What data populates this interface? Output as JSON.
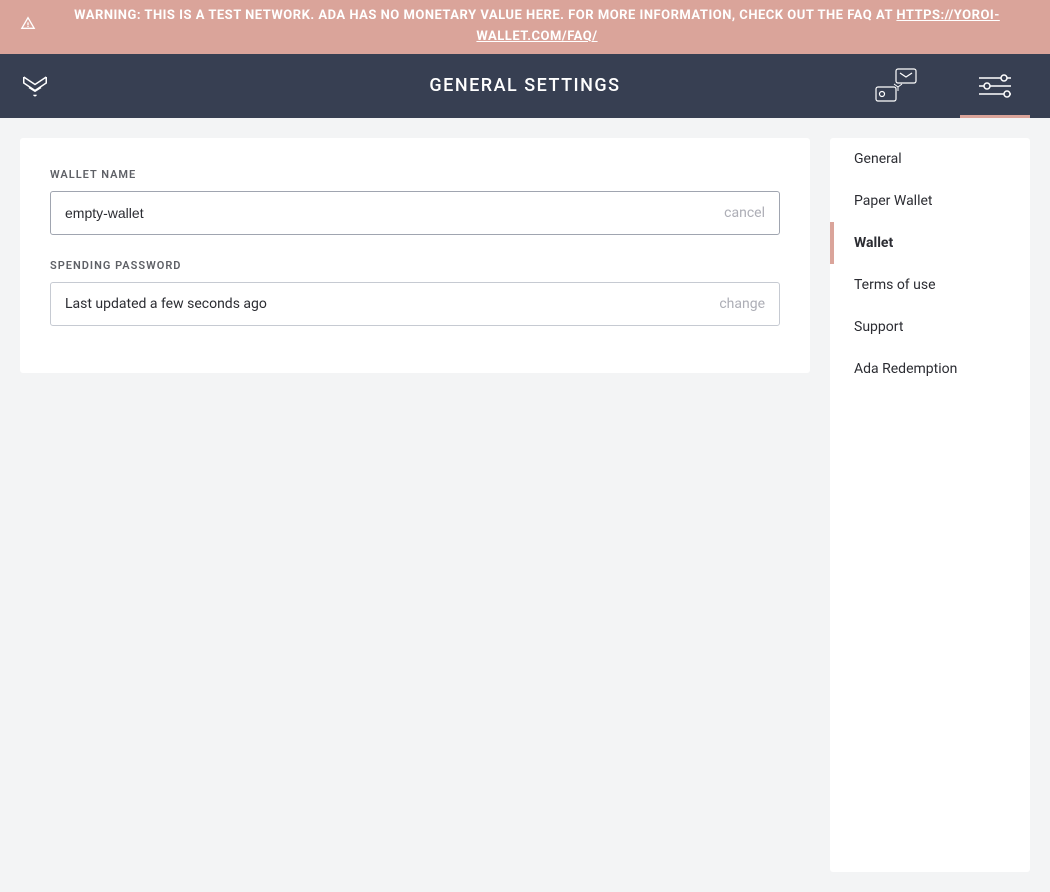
{
  "banner": {
    "warning_text": "WARNING: THIS IS A TEST NETWORK. ADA HAS NO MONETARY VALUE HERE. FOR MORE INFORMATION, CHECK OUT THE FAQ AT ",
    "faq_link_text": "HTTPS://YOROI-WALLET.COM/FAQ/"
  },
  "topbar": {
    "title": "GENERAL SETTINGS"
  },
  "main": {
    "wallet_name": {
      "label": "WALLET NAME",
      "value": "empty-wallet",
      "action": "cancel"
    },
    "spending_password": {
      "label": "SPENDING PASSWORD",
      "value": "Last updated a few seconds ago",
      "action": "change"
    }
  },
  "sidebar": {
    "items": [
      {
        "label": "General",
        "active": false
      },
      {
        "label": "Paper Wallet",
        "active": false
      },
      {
        "label": "Wallet",
        "active": true
      },
      {
        "label": "Terms of use",
        "active": false
      },
      {
        "label": "Support",
        "active": false
      },
      {
        "label": "Ada Redemption",
        "active": false
      }
    ]
  }
}
